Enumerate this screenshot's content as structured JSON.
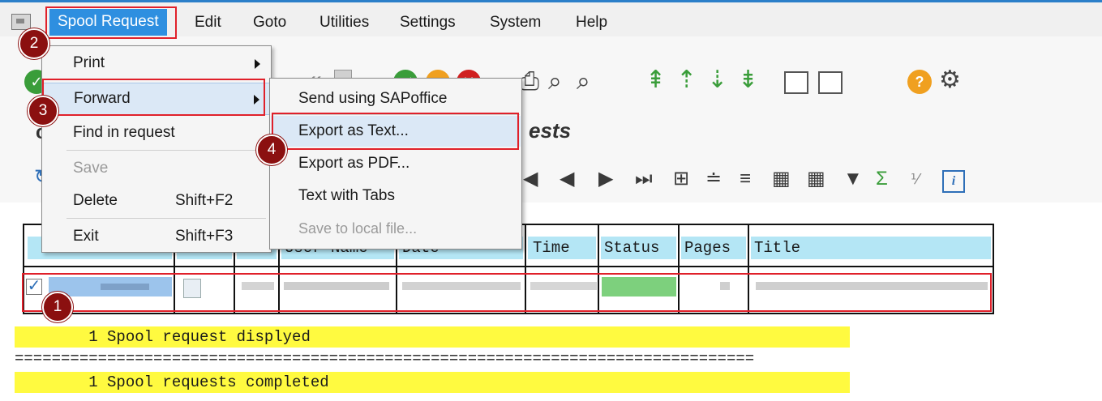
{
  "menubar": {
    "items": [
      "Spool Request",
      "Edit",
      "Goto",
      "Utilities",
      "Settings",
      "System",
      "Help"
    ]
  },
  "spool_menu": {
    "items": [
      {
        "label": "Print",
        "shortcut": ""
      },
      {
        "label": "Forward",
        "shortcut": ""
      },
      {
        "label": "Find in request",
        "shortcut": ""
      },
      {
        "label": "Save",
        "shortcut": ""
      },
      {
        "label": "Delete",
        "shortcut": "Shift+F2"
      },
      {
        "label": "Exit",
        "shortcut": "Shift+F3"
      }
    ]
  },
  "forward_menu": {
    "items": [
      "Send using SAPoffice",
      "Export as Text...",
      "Export as PDF...",
      "Text with Tabs",
      "Save to local file..."
    ]
  },
  "page_title_fragment": "ests",
  "table": {
    "headers": [
      "User Name",
      "Date",
      "Time",
      "Status",
      "Pages",
      "Title"
    ]
  },
  "log": {
    "line1": "        1 Spool request displyed",
    "separator": "================================================================================",
    "line2": "        1 Spool requests completed"
  },
  "badges": [
    "1",
    "2",
    "3",
    "4"
  ],
  "colors": {
    "menu_selected": "#2e8fe0",
    "highlight": "#dbe8f6",
    "header_cell": "#b4e6f5",
    "log_bg": "#fffa40",
    "annotation": "#8b1010",
    "redbox": "#e0202a"
  }
}
